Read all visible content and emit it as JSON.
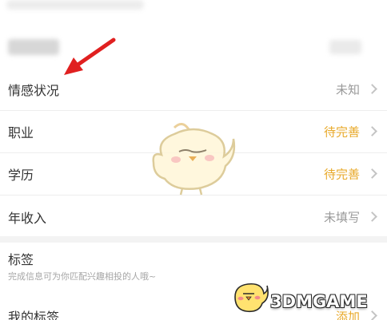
{
  "profile": {
    "rows": [
      {
        "label": "情感状况",
        "value": "未知",
        "value_color": "#999999"
      },
      {
        "label": "职业",
        "value": "待完善",
        "value_color": "#e8a92a"
      },
      {
        "label": "学历",
        "value": "待完善",
        "value_color": "#e8a92a"
      },
      {
        "label": "年收入",
        "value": "未填写",
        "value_color": "#999999"
      }
    ]
  },
  "tags": {
    "title": "标签",
    "hint": "完成信息可为你匹配兴趣相投的人哦~",
    "my_tags_label": "我的标签",
    "add_label": "添加"
  },
  "watermark": {
    "text": "3DMGAME"
  },
  "icons": {
    "annotation_arrow": "red-arrow-icon",
    "mascot": "chick-mascot-icon",
    "chevron": "chevron-right-icon"
  },
  "colors": {
    "accent": "#e8a92a",
    "muted": "#999999",
    "arrow": "#e02020"
  }
}
